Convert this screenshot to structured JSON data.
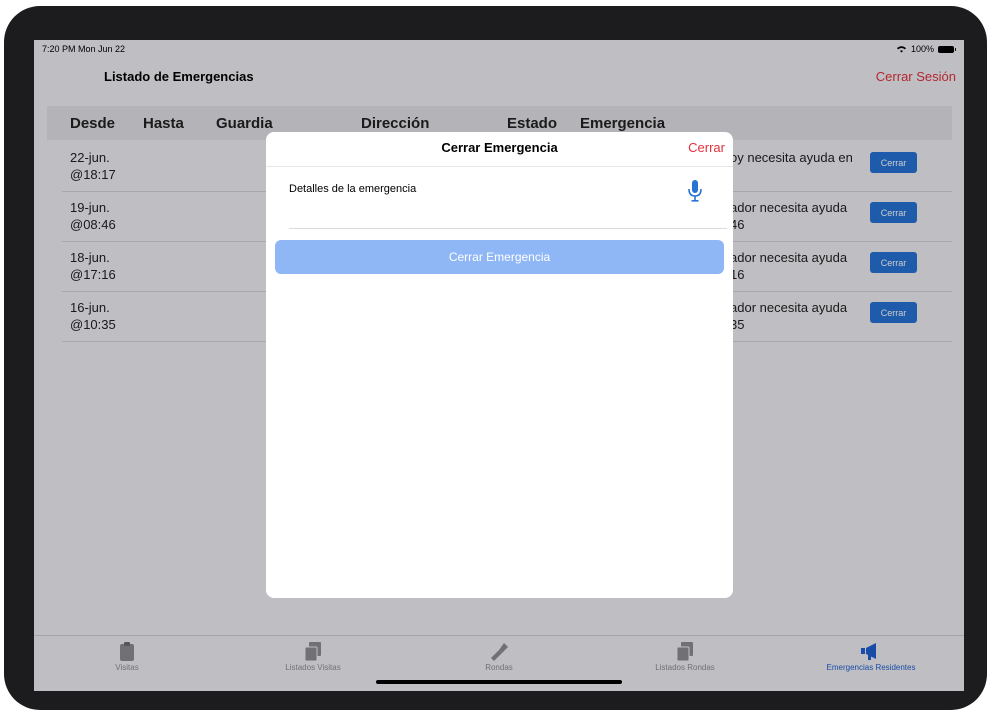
{
  "status_bar": {
    "time": "7:20 PM  Mon Jun 22",
    "battery": "100%"
  },
  "nav": {
    "title": "Listado de Emergencias",
    "logout": "Cerrar Sesión"
  },
  "table": {
    "headers": [
      "Desde",
      "Hasta",
      "Guardia",
      "Dirección",
      "Estado",
      "Emergencia"
    ],
    "rows": [
      {
        "date_line1": "22-jun.",
        "date_line2": "@18:17",
        "em_line1": "oy necesita ayuda en",
        "em_line2": "",
        "action": "Cerrar"
      },
      {
        "date_line1": "19-jun.",
        "date_line2": "@08:46",
        "em_line1": "ador necesita ayuda",
        "em_line2": "46",
        "action": "Cerrar"
      },
      {
        "date_line1": "18-jun.",
        "date_line2": "@17:16",
        "em_line1": "ador necesita ayuda",
        "em_line2": "16",
        "action": "Cerrar"
      },
      {
        "date_line1": "16-jun.",
        "date_line2": "@10:35",
        "em_line1": "ador necesita ayuda",
        "em_line2": "35",
        "action": "Cerrar"
      }
    ]
  },
  "modal": {
    "title": "Cerrar Emergencia",
    "close": "Cerrar",
    "field_label": "Detalles de la emergencia",
    "submit": "Cerrar Emergencia"
  },
  "tabs": [
    {
      "label": "Visitas",
      "icon": "clipboard-icon",
      "active": false
    },
    {
      "label": "Listados Visitas",
      "icon": "documents-icon",
      "active": false
    },
    {
      "label": "Rondas",
      "icon": "flashlight-icon",
      "active": false
    },
    {
      "label": "Listados Rondas",
      "icon": "documents-icon",
      "active": false
    },
    {
      "label": "Emergencias Residentes",
      "icon": "megaphone-icon",
      "active": true
    }
  ],
  "colors": {
    "accent_red": "#e0313d",
    "accent_blue": "#2672d5",
    "disabled_blue": "#8fb6f5",
    "active_tab": "#2060d0"
  }
}
